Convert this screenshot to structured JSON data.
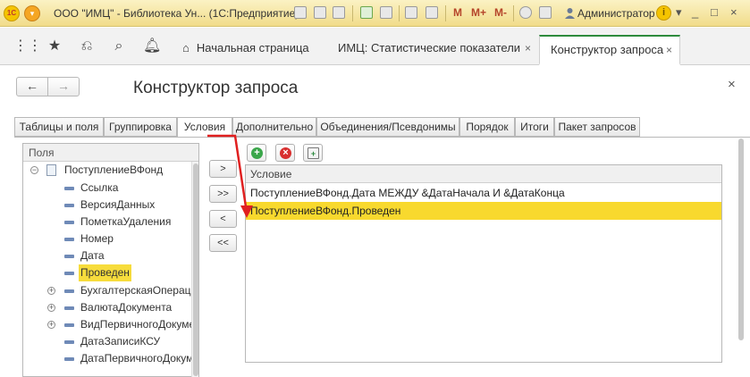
{
  "window": {
    "title": "ООО \"ИМЦ\" - Библиотека Ун... (1С:Предприятие)",
    "toolbar_m": [
      "M",
      "M+",
      "M-"
    ],
    "user": "Администратор"
  },
  "nav": {
    "tabs": [
      {
        "label": "Начальная страница"
      },
      {
        "label": "ИМЦ: Статистические показатели"
      },
      {
        "label": "Конструктор запроса"
      }
    ]
  },
  "form": {
    "title": "Конструктор запроса",
    "back_label": "←",
    "forward_label": "→",
    "close_label": "×"
  },
  "inner_tabs": [
    "Таблицы и поля",
    "Группировка",
    "Условия",
    "Дополнительно",
    "Объединения/Псевдонимы",
    "Порядок",
    "Итоги",
    "Пакет запросов"
  ],
  "fields": {
    "header": "Поля",
    "items": [
      {
        "label": "ПоступлениеВФонд",
        "kind": "table",
        "expander": "−"
      },
      {
        "label": "Ссылка",
        "kind": "field"
      },
      {
        "label": "ВерсияДанных",
        "kind": "field"
      },
      {
        "label": "ПометкаУдаления",
        "kind": "field"
      },
      {
        "label": "Номер",
        "kind": "field"
      },
      {
        "label": "Дата",
        "kind": "field"
      },
      {
        "label": "Проведен",
        "kind": "field",
        "highlighted": true
      },
      {
        "label": "БухгалтерскаяОперация",
        "kind": "field",
        "expander": "+"
      },
      {
        "label": "ВалютаДокумента",
        "kind": "field",
        "expander": "+"
      },
      {
        "label": "ВидПервичногоДокумента",
        "kind": "field",
        "expander": "+"
      },
      {
        "label": "ДатаЗаписиКСУ",
        "kind": "field"
      },
      {
        "label": "ДатаПервичногоДокумента",
        "kind": "field"
      }
    ]
  },
  "move_buttons": [
    ">",
    ">>",
    "<",
    "<<"
  ],
  "conditions": {
    "header": "Условие",
    "rows": [
      {
        "text": "ПоступлениеВФонд.Дата МЕЖДУ &ДатаНачала И &ДатаКонца",
        "selected": false
      },
      {
        "text": "ПоступлениеВФонд.Проведен",
        "selected": true
      }
    ]
  },
  "colors": {
    "accent_green": "#2e8b3d",
    "selection_yellow": "#f8d92e",
    "arrow_red": "#e02020"
  }
}
